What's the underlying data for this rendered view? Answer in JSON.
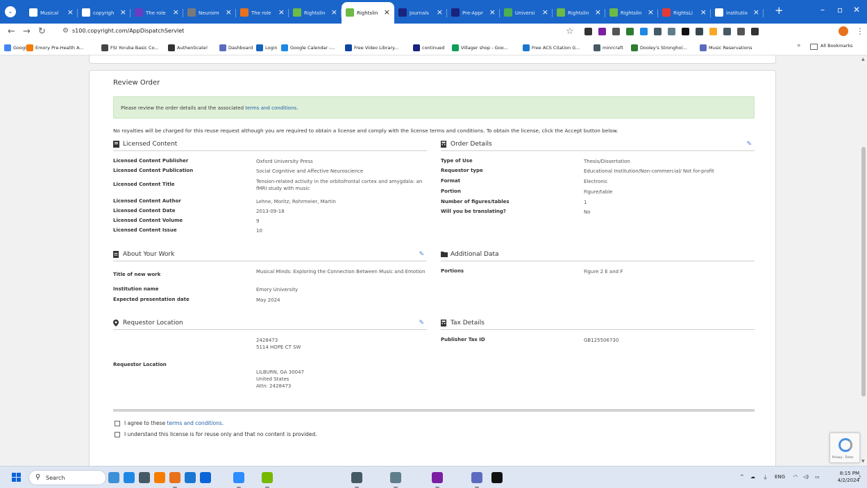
{
  "tabs": [
    {
      "label": "Musical",
      "icon_color": "#ffffff",
      "active": false
    },
    {
      "label": "copyrigh",
      "icon_color": "#ffffff",
      "active": false
    },
    {
      "label": "The role",
      "icon_color": "#6a3cc2",
      "active": false
    },
    {
      "label": "Neuroim",
      "icon_color": "#7a7a7a",
      "active": false
    },
    {
      "label": "The role",
      "icon_color": "#e8711c",
      "active": false
    },
    {
      "label": "Rightslin",
      "icon_color": "#6dbb45",
      "active": false
    },
    {
      "label": "Rightslin",
      "icon_color": "#6dbb45",
      "active": true
    },
    {
      "label": "Journals",
      "icon_color": "#1a237e",
      "active": false
    },
    {
      "label": "Pre-Appr",
      "icon_color": "#1a237e",
      "active": false
    },
    {
      "label": "Universi",
      "icon_color": "#4caf50",
      "active": false
    },
    {
      "label": "Rightslin",
      "icon_color": "#6dbb45",
      "active": false
    },
    {
      "label": "Rightslin",
      "icon_color": "#6dbb45",
      "active": false
    },
    {
      "label": "RightsLi",
      "icon_color": "#e53935",
      "active": false
    },
    {
      "label": "institutio",
      "icon_color": "#ffffff",
      "active": false
    }
  ],
  "address_bar": {
    "url": "s100.copyright.com/AppDispatchServlet"
  },
  "extension_colors": [
    "#333333",
    "#7b1fa2",
    "#555555",
    "#2e7d32",
    "#1e88e5",
    "#455a64",
    "#607d8b",
    "#111111",
    "#37474f",
    "#f9a825",
    "#455a64",
    "#555555",
    "#333333"
  ],
  "bookmarks": [
    {
      "label": "Google",
      "color": "#4285f4"
    },
    {
      "label": "Emory Pre-Health A...",
      "color": "#f57c00"
    },
    {
      "label": "FSI Yoruba Basic Co...",
      "color": "#444444"
    },
    {
      "label": "Authenticate!",
      "color": "#333333"
    },
    {
      "label": "Dashboard",
      "color": "#5c6bc0"
    },
    {
      "label": "Login",
      "color": "#1565c0"
    },
    {
      "label": "Google Calendar -...",
      "color": "#1e88e5"
    },
    {
      "label": "Free Video Library...",
      "color": "#0d47a1"
    },
    {
      "label": "continued",
      "color": "#1a237e"
    },
    {
      "label": "Villager shop - Goo...",
      "color": "#0f9d58"
    },
    {
      "label": "Free ACS Citation G...",
      "color": "#1976d2"
    },
    {
      "label": "minrcraft",
      "color": "#455a64"
    },
    {
      "label": "Dooley's Stronghol...",
      "color": "#2e7d32"
    },
    {
      "label": "Music Reservations",
      "color": "#5c6bc0"
    }
  ],
  "all_bookmarks": "All Bookmarks",
  "page": {
    "title": "Review Order",
    "notice_prefix": "Please review the order details and the associated ",
    "notice_link": "terms and conditions",
    "notice_suffix": ".",
    "royalty_text": "No royalties will be charged for this reuse request although you are required to obtain a license and comply with the license terms and conditions. To obtain the license, click the Accept button below."
  },
  "licensed_content": {
    "title": "Licensed Content",
    "rows": [
      {
        "label": "Licensed Content Publisher",
        "value": "Oxford University Press"
      },
      {
        "label": "Licensed Content Publication",
        "value": "Social Cognitive and Affective Neuroscience"
      },
      {
        "label": "Licensed Content Title",
        "value": "Tension-related activity in the orbitofrontal cortex and amygdala: an fMRI study with music"
      },
      {
        "label": "Licensed Content Author",
        "value": "Lehne, Moritz; Rohrmeier, Martin"
      },
      {
        "label": "Licensed Content Date",
        "value": "2013-09-18"
      },
      {
        "label": "Licensed Content Volume",
        "value": "9"
      },
      {
        "label": "Licensed Content Issue",
        "value": "10"
      }
    ]
  },
  "order_details": {
    "title": "Order Details",
    "rows": [
      {
        "label": "Type of Use",
        "value": "Thesis/Dissertation"
      },
      {
        "label": "Requestor type",
        "value": "Educational Institution/Non-commercial/ Not for-profit"
      },
      {
        "label": "Format",
        "value": "Electronic"
      },
      {
        "label": "Portion",
        "value": "Figure/table"
      },
      {
        "label": "Number of figures/tables",
        "value": "1"
      },
      {
        "label": "Will you be translating?",
        "value": "No"
      }
    ]
  },
  "about_work": {
    "title": "About Your Work",
    "rows": [
      {
        "label": "Title of new work",
        "value": "Musical Minds: Exploring the Connection Between Music and Emotion"
      },
      {
        "label": "Institution name",
        "value": "Emory University"
      },
      {
        "label": "Expected presentation date",
        "value": "May 2024"
      }
    ]
  },
  "additional_data": {
    "title": "Additional Data",
    "rows": [
      {
        "label": "Portions",
        "value": "Figure 2 E and F"
      }
    ]
  },
  "requestor_location": {
    "title": "Requestor Location",
    "label": "Requestor Location",
    "address_top": [
      "2428473",
      "5114 HOPE CT SW"
    ],
    "address_bottom": [
      "LILBURN, GA 30047",
      "United States",
      "Attn: 2428473"
    ]
  },
  "tax_details": {
    "title": "Tax Details",
    "rows": [
      {
        "label": "Publisher Tax ID",
        "value": "GB125506730"
      }
    ]
  },
  "agreements": [
    {
      "prefix": "I agree to these ",
      "link": "terms and conditions",
      "suffix": "."
    },
    {
      "prefix": "I understand this license is for reuse only and that no content is provided.",
      "link": "",
      "suffix": ""
    }
  ],
  "recaptcha": {
    "text": "Privacy - Terms"
  },
  "taskbar": {
    "search_placeholder": "Search",
    "time": "8:15 PM",
    "date": "4/2/2024",
    "language": "ENG",
    "apps": [
      {
        "name": "files",
        "color": "#3d8fd6"
      },
      {
        "name": "app-2",
        "color": "#1e88e5"
      },
      {
        "name": "app-3",
        "color": "#455a64"
      },
      {
        "name": "app-4",
        "color": "#f57c00"
      },
      {
        "name": "chrome",
        "color": "#e8711c"
      },
      {
        "name": "app-6",
        "color": "#1976d2"
      },
      {
        "name": "store",
        "color": "#0a64d8"
      },
      {
        "name": "zoom",
        "color": "#2d8cff"
      },
      {
        "name": "nvidia",
        "color": "#76b900"
      },
      {
        "name": "calculator",
        "color": "#455a64"
      },
      {
        "name": "app-11",
        "color": "#607d8b"
      },
      {
        "name": "onenote",
        "color": "#7b1fa2"
      },
      {
        "name": "teams",
        "color": "#5c6bc0"
      },
      {
        "name": "notion",
        "color": "#111111"
      }
    ]
  }
}
